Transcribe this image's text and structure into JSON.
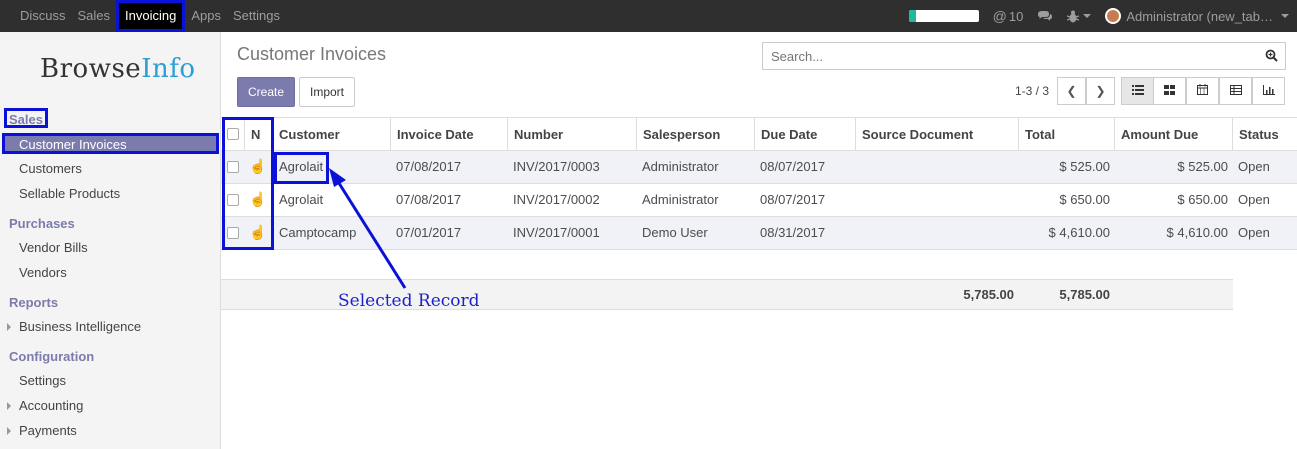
{
  "topbar": {
    "menu": [
      "Discuss",
      "Sales",
      "Invoicing",
      "Apps",
      "Settings"
    ],
    "active": "Invoicing",
    "progress_fraction": 0.1,
    "notifications": "10",
    "user": "Administrator (new_tab…"
  },
  "brand": {
    "part1": "Browse",
    "part2": "Info"
  },
  "sidebar": {
    "sales_head": "Sales",
    "active_item": "Customer Invoices",
    "customers": "Customers",
    "sellable": "Sellable Products",
    "purchases_head": "Purchases",
    "vendor_bills": "Vendor Bills",
    "vendors": "Vendors",
    "reports_head": "Reports",
    "bi": "Business Intelligence",
    "config_head": "Configuration",
    "settings": "Settings",
    "accounting": "Accounting",
    "payments": "Payments"
  },
  "control": {
    "title": "Customer Invoices",
    "create": "Create",
    "import": "Import",
    "search_placeholder": "Search...",
    "pager": "1-3 / 3",
    "prev_icon": "chevron-left-icon",
    "next_icon": "chevron-right-icon",
    "views": [
      "list-view-icon",
      "kanban-view-icon",
      "calendar-view-icon",
      "pivot-view-icon",
      "graph-view-icon"
    ]
  },
  "table": {
    "headers": {
      "n": "N",
      "customer": "Customer",
      "invoice_date": "Invoice Date",
      "number": "Number",
      "salesperson": "Salesperson",
      "due_date": "Due Date",
      "source": "Source Document",
      "total": "Total",
      "amount_due": "Amount Due",
      "status": "Status"
    },
    "rows": [
      {
        "customer": "Agrolait",
        "invoice_date": "07/08/2017",
        "number": "INV/2017/0003",
        "salesperson": "Administrator",
        "due_date": "08/07/2017",
        "source": "",
        "total": "$ 525.00",
        "amount_due": "$ 525.00",
        "status": "Open"
      },
      {
        "customer": "Agrolait",
        "invoice_date": "07/08/2017",
        "number": "INV/2017/0002",
        "salesperson": "Administrator",
        "due_date": "08/07/2017",
        "source": "",
        "total": "$ 650.00",
        "amount_due": "$ 650.00",
        "status": "Open"
      },
      {
        "customer": "Camptocamp",
        "invoice_date": "07/01/2017",
        "number": "INV/2017/0001",
        "salesperson": "Demo User",
        "due_date": "08/31/2017",
        "source": "",
        "total": "$ 4,610.00",
        "amount_due": "$ 4,610.00",
        "status": "Open"
      }
    ],
    "sum_total": "5,785.00",
    "sum_due": "5,785.00"
  },
  "annotation": {
    "label": "Selected Record",
    "color": "#0a12d8"
  }
}
